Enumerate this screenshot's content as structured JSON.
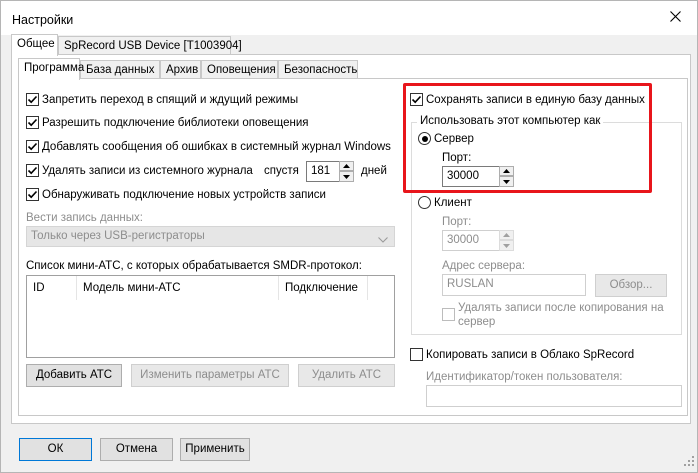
{
  "window": {
    "title": "Настройки"
  },
  "outer_tabs": [
    {
      "label": "Общее"
    },
    {
      "label": "SpRecord USB Device [T1003904]"
    }
  ],
  "inner_tabs": [
    {
      "label": "Программа"
    },
    {
      "label": "База данных"
    },
    {
      "label": "Архив"
    },
    {
      "label": "Оповещения"
    },
    {
      "label": "Безопасность"
    }
  ],
  "left": {
    "checkboxes": [
      {
        "label": "Запретить переход в спящий и ждущий режимы",
        "checked": true
      },
      {
        "label": "Разрешить подключение библиотеки оповещения",
        "checked": true
      },
      {
        "label": "Добавлять сообщения об ошибках в системный журнал Windows",
        "checked": true
      },
      {
        "label": "Удалять записи из системного журнала",
        "checked": true
      },
      {
        "label": "Обнаруживать подключение новых устройств записи",
        "checked": true
      }
    ],
    "delete_after_label": "спустя",
    "delete_days_value": "181",
    "days_label": "дней",
    "record_data_label": "Вести запись данных:",
    "record_data_value": "Только через USB-регистраторы",
    "list_label": "Список мини-АТС, с которых обрабатывается SMDR-протокол:",
    "columns": [
      "ID",
      "Модель мини-АТС",
      "Подключение"
    ],
    "buttons": {
      "add": "Добавить АТС",
      "edit": "Изменить параметры АТС",
      "delete": "Удалить АТС"
    }
  },
  "right": {
    "single_db_label": "Сохранять записи в единую базу данных",
    "use_computer_as": "Использовать этот компьютер как",
    "server_label": "Сервер",
    "port_label": "Порт:",
    "server_port_value": "30000",
    "client_label": "Клиент",
    "client_port_value": "30000",
    "server_address_label": "Адрес сервера:",
    "server_address_value": "RUSLAN",
    "browse_button": "Обзор...",
    "delete_after_copy_line1": "Удалять записи после копирования на",
    "delete_after_copy_line2": "сервер",
    "cloud_label": "Копировать записи в Облако SpRecord",
    "token_label": "Идентификатор/токен пользователя:",
    "token_value": ""
  },
  "footer": {
    "ok": "ОК",
    "cancel": "Отмена",
    "apply": "Применить"
  },
  "colors": {
    "highlight": "#e8151b",
    "focus": "#0078d7"
  }
}
